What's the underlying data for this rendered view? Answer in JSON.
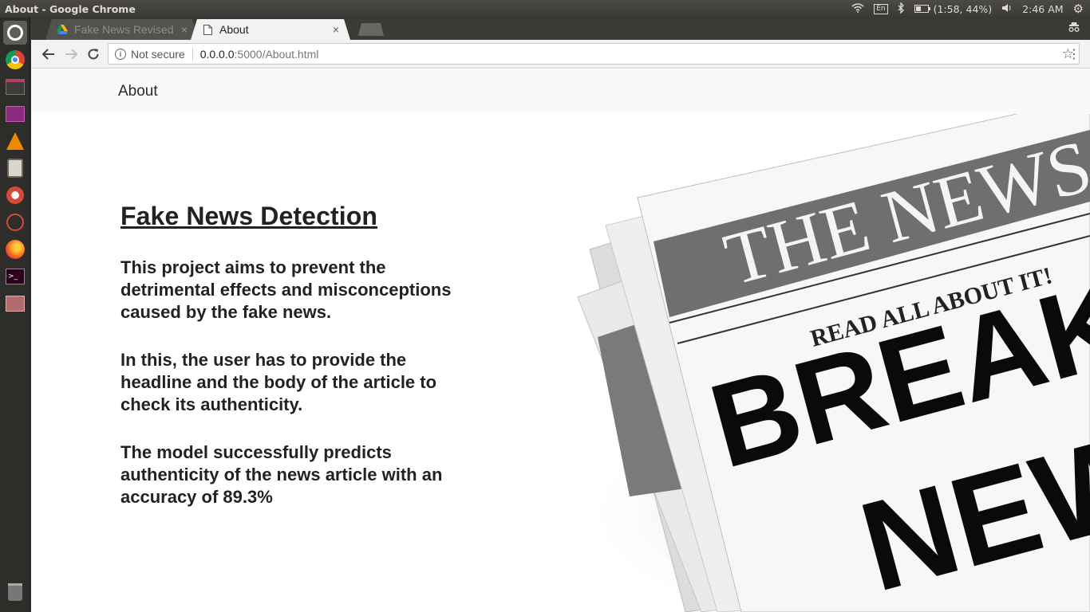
{
  "os": {
    "window_title": "About - Google Chrome",
    "keyboard_layout": "En",
    "battery": "(1:58, 44%)",
    "clock": "2:46 AM"
  },
  "launcher": {
    "items": [
      "ubuntu-dash-icon",
      "chrome-icon",
      "files-icon",
      "media-icon",
      "vlc-icon",
      "app-icon",
      "settings-icon",
      "network-icon",
      "firefox-icon",
      "terminal-icon",
      "drawer-icon",
      "trash-icon"
    ]
  },
  "browser": {
    "tabs": [
      {
        "label": "Fake News Revised",
        "icon": "google-drive-icon",
        "active": false
      },
      {
        "label": "About",
        "icon": "page-icon",
        "active": true
      }
    ],
    "close_glyph": "×",
    "security_label": "Not secure",
    "url_host": "0.0.0.0",
    "url_path": ":5000/About.html"
  },
  "page": {
    "nav_brand": "About",
    "heading": "Fake News Detection",
    "paragraphs": [
      "This project aims to prevent the detrimental effects and misconceptions caused by the fake news.",
      "In this, the user has to provide the headline and the body of the article to check its authenticity.",
      "The model successfully predicts authenticity of the news article with an accuracy of 89.3%"
    ],
    "image": {
      "masthead": "THE NEWS",
      "tagline": "READ ALL ABOUT IT!",
      "headline_1": "BREAKING",
      "headline_2": "NEWS"
    }
  }
}
